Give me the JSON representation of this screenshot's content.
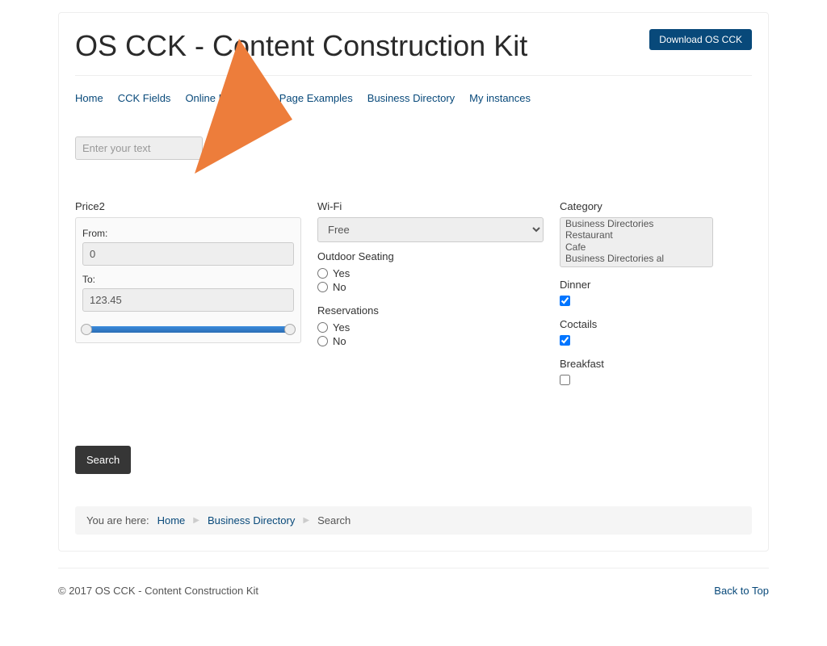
{
  "header": {
    "title": "OS CCK - Content Construction Kit",
    "download_label": "Download OS CCK"
  },
  "nav": {
    "items": [
      "Home",
      "CCK Fields",
      "Online Examples",
      "Page Examples",
      "Business Directory",
      "My instances"
    ]
  },
  "search_top": {
    "placeholder": "Enter your text"
  },
  "filters": {
    "price2": {
      "label": "Price2",
      "from_label": "From:",
      "from_value": "0",
      "to_label": "To:",
      "to_value": "123.45"
    },
    "wifi": {
      "label": "Wi-Fi",
      "value": "Free"
    },
    "outdoor": {
      "label": "Outdoor Seating",
      "options": [
        "Yes",
        "No"
      ]
    },
    "reservations": {
      "label": "Reservations",
      "options": [
        "Yes",
        "No"
      ]
    },
    "category": {
      "label": "Category",
      "options": [
        "Business Directories",
        "Restaurant",
        "Cafe",
        "Business Directories al"
      ]
    },
    "dinner": {
      "label": "Dinner",
      "checked": true
    },
    "coctails": {
      "label": "Coctails",
      "checked": true
    },
    "breakfast": {
      "label": "Breakfast",
      "checked": false
    }
  },
  "actions": {
    "search_label": "Search"
  },
  "breadcrumb": {
    "prefix": "You are here:",
    "items": [
      "Home",
      "Business Directory",
      "Search"
    ]
  },
  "footer": {
    "copyright": "© 2017 OS CCK - Content Construction Kit",
    "back_to_top": "Back to Top"
  }
}
